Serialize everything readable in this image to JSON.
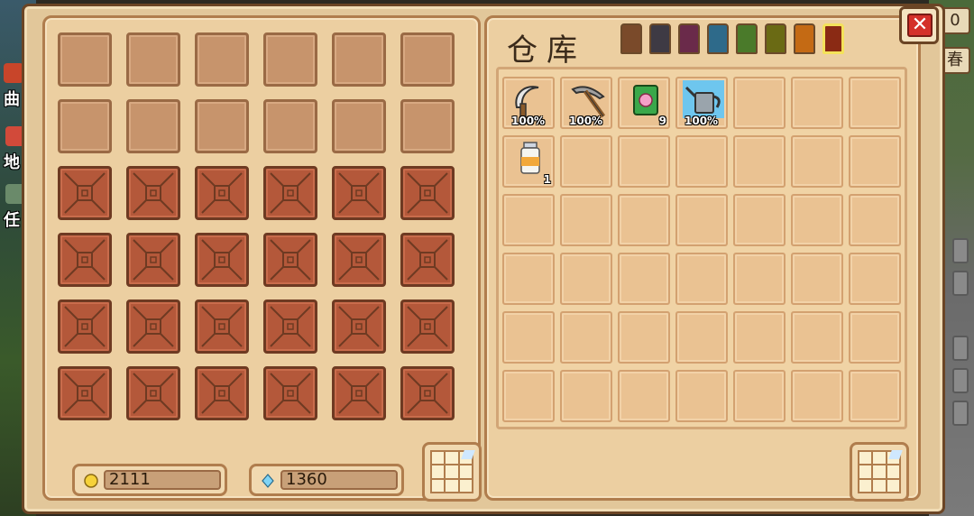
{
  "side_left": {
    "tabs": [
      "曲",
      "地",
      "任"
    ]
  },
  "side_right": {
    "chips": [
      "0",
      "春"
    ]
  },
  "left_panel": {
    "slots": [
      "empty",
      "empty",
      "empty",
      "empty",
      "empty",
      "empty",
      "empty",
      "empty",
      "empty",
      "empty",
      "empty",
      "empty",
      "locked",
      "locked",
      "locked",
      "locked",
      "locked",
      "locked",
      "locked",
      "locked",
      "locked",
      "locked",
      "locked",
      "locked",
      "locked",
      "locked",
      "locked",
      "locked",
      "locked",
      "locked",
      "locked",
      "locked",
      "locked",
      "locked",
      "locked",
      "locked"
    ],
    "coins": "2111",
    "gems": "1360"
  },
  "storage": {
    "title": "仓库",
    "tab_colors": [
      "#7a4a2a",
      "#3e3a44",
      "#6a2a4a",
      "#2e6a8a",
      "#4a7a2a",
      "#6a6a14",
      "#c46a14",
      "#8a2a14"
    ],
    "active_tab": 7,
    "items": [
      {
        "slot": 0,
        "icon": "sickle-icon",
        "durability": "100%"
      },
      {
        "slot": 1,
        "icon": "pickaxe-icon",
        "durability": "100%"
      },
      {
        "slot": 2,
        "icon": "seed-bag-icon",
        "quantity": "9"
      },
      {
        "slot": 3,
        "icon": "watering-can-icon",
        "durability": "100%"
      },
      {
        "slot": 7,
        "icon": "milk-bottle-icon",
        "quantity": "1"
      }
    ],
    "rows": 6,
    "cols": 7
  }
}
